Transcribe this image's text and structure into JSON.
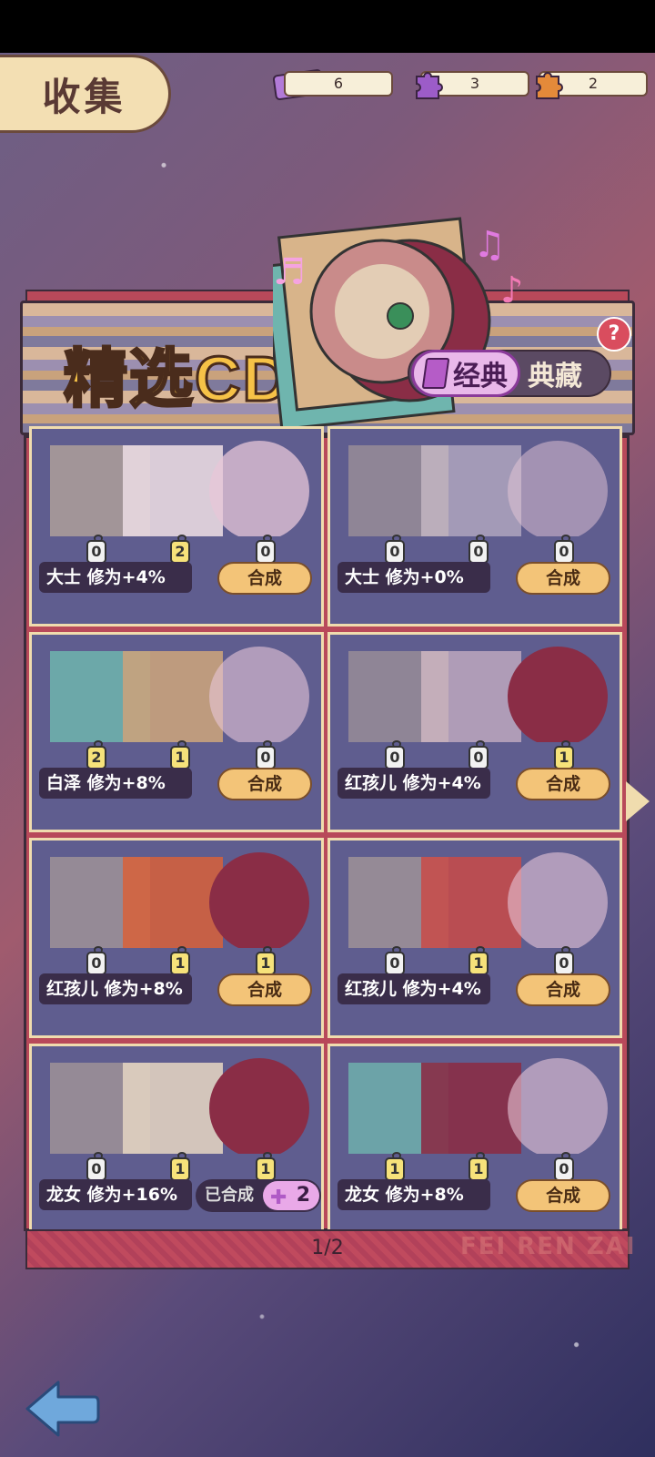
{
  "header": {
    "title": "收集"
  },
  "resources": [
    {
      "icon": "ticket-icon",
      "value": "6"
    },
    {
      "icon": "purple-puzzle-icon",
      "value": "3"
    },
    {
      "icon": "orange-puzzle-icon",
      "value": "2"
    }
  ],
  "banner": {
    "title": "精选CD",
    "toggle": {
      "active": "经典",
      "inactive": "典藏"
    }
  },
  "cards": [
    {
      "label": "大士  修为+4%",
      "counts": [
        "0",
        "2",
        "0"
      ],
      "button": "合成"
    },
    {
      "label": "大士  修为+0%",
      "counts": [
        "0",
        "0",
        "0"
      ],
      "button": "合成"
    },
    {
      "label": "白泽  修为+8%",
      "counts": [
        "2",
        "1",
        "0"
      ],
      "button": "合成"
    },
    {
      "label": "红孩儿 修为+4%",
      "counts": [
        "0",
        "0",
        "1"
      ],
      "button": "合成"
    },
    {
      "label": "红孩儿 修为+8%",
      "counts": [
        "0",
        "1",
        "1"
      ],
      "button": "合成"
    },
    {
      "label": "红孩儿 修为+4%",
      "counts": [
        "0",
        "1",
        "0"
      ],
      "button": "合成"
    },
    {
      "label": "龙女  修为+16%",
      "counts": [
        "0",
        "1",
        "1"
      ],
      "done": "已合成",
      "done_count": "2"
    },
    {
      "label": "龙女  修为+8%",
      "counts": [
        "1",
        "1",
        "0"
      ],
      "button": "合成"
    }
  ],
  "pager": "1/2",
  "brand": "FEI REN ZAI",
  "colors": {
    "button": "#f3c478",
    "card": "#5f5d8f",
    "frame": "#b8495a",
    "title": "#f6c247"
  }
}
